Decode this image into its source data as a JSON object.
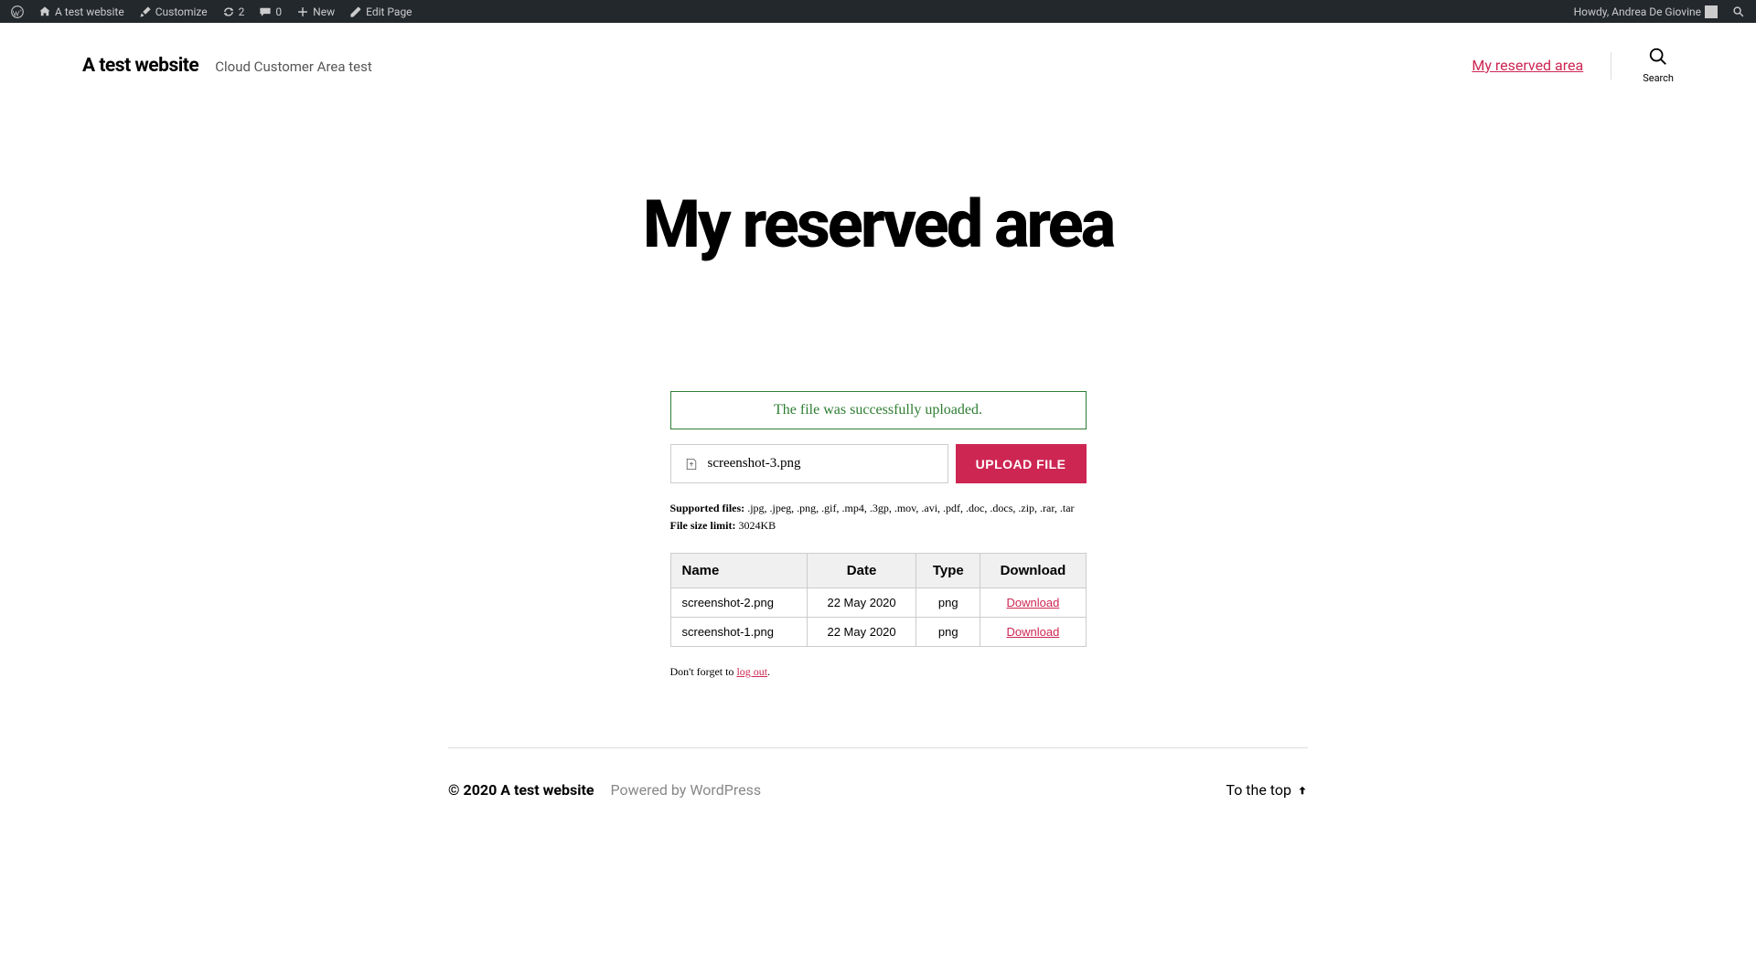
{
  "adminBar": {
    "siteName": "A test website",
    "customize": "Customize",
    "updates": "2",
    "comments": "0",
    "new": "New",
    "editPage": "Edit Page",
    "greeting": "Howdy, Andrea De Giovine"
  },
  "header": {
    "siteTitle": "A test website",
    "tagline": "Cloud Customer Area test",
    "navLink": "My reserved area",
    "searchLabel": "Search"
  },
  "page": {
    "title": "My reserved area",
    "successMessage": "The file was successfully uploaded.",
    "selectedFile": "screenshot-3.png",
    "uploadButton": "UPLOAD FILE",
    "supportedLabel": "Supported files:",
    "supportedValue": ".jpg, .jpeg, .png, .gif, .mp4, .3gp, .mov, .avi, .pdf, .doc, .docs, .zip, .rar, .tar",
    "sizeLimitLabel": "File size limit:",
    "sizeLimitValue": "3024KB",
    "table": {
      "headers": {
        "name": "Name",
        "date": "Date",
        "type": "Type",
        "download": "Download"
      },
      "rows": [
        {
          "name": "screenshot-2.png",
          "date": "22 May 2020",
          "type": "png",
          "download": "Download"
        },
        {
          "name": "screenshot-1.png",
          "date": "22 May 2020",
          "type": "png",
          "download": "Download"
        }
      ]
    },
    "logoutPrefix": "Don't forget to ",
    "logoutLink": "log out",
    "logoutSuffix": "."
  },
  "footer": {
    "copyright": "© 2020 A test website",
    "powered": "Powered by WordPress",
    "toTop": "To the top"
  }
}
